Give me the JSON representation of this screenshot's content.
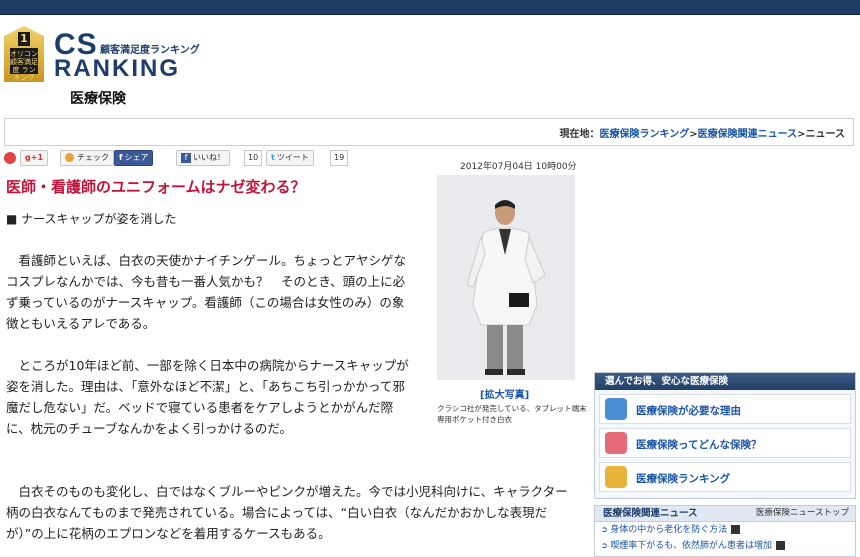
{
  "header": {
    "logo_text": "オリコン 顧客満足度 ランキング",
    "logo_number": "1",
    "brand_cs": "CS",
    "brand_sub": "顧客満足度ランキング",
    "brand_ranking": "RANKING",
    "category_title": "医療保険"
  },
  "breadcrumb": {
    "prefix": "現在地：",
    "items": [
      "医療保険ランキング",
      "医療保険関連ニュース",
      "ニュース"
    ],
    "separator": ">"
  },
  "social": {
    "gplus_label": "+1",
    "check_label": "チェック",
    "share_label": "シェア",
    "like_label": "いいね！",
    "like_count": "10",
    "tweet_label": "ツイート",
    "tweet_count": "19"
  },
  "article": {
    "date": "2012年07月04日 10時00分",
    "headline": "医師・看護師のユニフォームはナゼ変わる？",
    "subheading": "■ ナースキャップが姿を消した",
    "paragraphs": [
      "　看護師といえば、白衣の天使かナイチンゲール。ちょっとアヤシゲなコスプレなんかでは、今も昔も一番人気かも？　そのとき、頭の上に必ず乗っているのがナースキャップ。看護師（この場合は女性のみ）の象徴ともいえるアレである。",
      "　ところが10年ほど前、一部を除く日本中の病院からナースキャップが姿を消した。理由は、「意外なほど不潔」と、「あちこち引っかかって邪魔だし危ない」だ。ベッドで寝ている患者をケアしようとかがんだ際に、枕元のチューブなんかをよく引っかけるのだ。",
      "　白衣そのものも変化し、白ではなくブルーやピンクが増えた。今では小児科向けに、キャラクター柄の白衣なんてものまで発売されている。場合によっては、“白い白衣（なんだかおかしな表現だが）”の上に花柄のエプロンなどを着用するケースもある。"
    ],
    "photo_link": "[拡大写真]",
    "photo_caption": "クラシコ社が発売している、タブレット端末専用ポケット付き白衣"
  },
  "sidebar": {
    "heading": "選んでお得、安心な医療保険",
    "items": [
      {
        "label": "医療保険が必要な理由",
        "icon": "hospital-icon",
        "color": "#4a8fd6"
      },
      {
        "label": "医療保険ってどんな保険？",
        "icon": "stethoscope-icon",
        "color": "#e56a7a"
      },
      {
        "label": "医療保険ランキング",
        "icon": "crown-icon",
        "color": "#e8b33a"
      }
    ]
  },
  "news": {
    "heading": "医療保険関連ニュース",
    "more_link": "医療保険ニューストップ",
    "items": [
      "身体の中から老化を防ぐ方法",
      "喫煙率下がるも、依然肺がん患者は増加"
    ]
  },
  "colors": {
    "headline": "#c0153b",
    "link": "#1b55a8",
    "navy": "#1f3a63"
  }
}
